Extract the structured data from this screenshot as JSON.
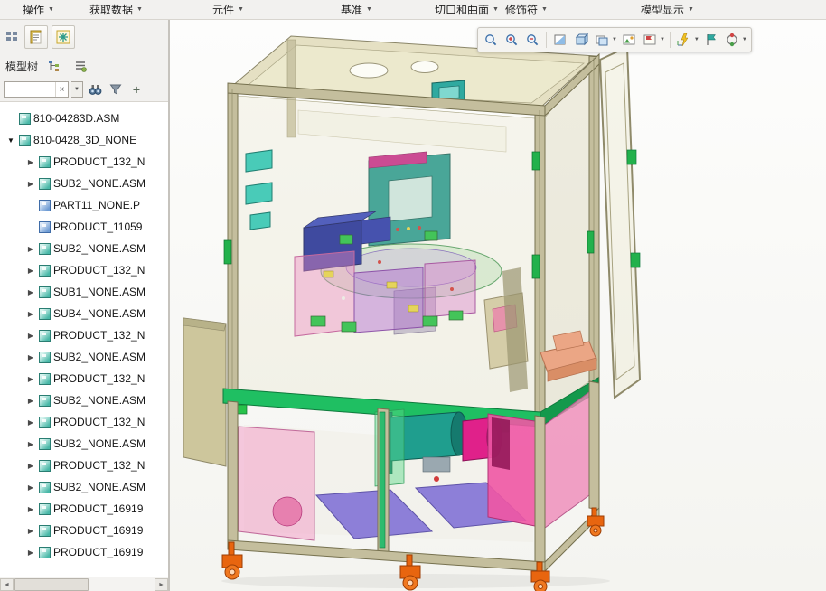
{
  "icons": {
    "caret_glyph": "▼",
    "expander_open": "▼",
    "expander_closed": "▶",
    "clear_glyph": "×",
    "plus_glyph": "+",
    "scroll_left_glyph": "◄",
    "scroll_right_glyph": "►"
  },
  "menubar": {
    "items": [
      {
        "label": "操作"
      },
      {
        "label": "获取数据"
      },
      {
        "label": "元件"
      },
      {
        "label": "基准"
      },
      {
        "label": "切口和曲面"
      },
      {
        "label": "修饰符"
      },
      {
        "label": "模型显示"
      }
    ]
  },
  "quick_access": {
    "buttons": [
      {
        "name": "navigator-toggle"
      },
      {
        "name": "paste"
      },
      {
        "name": "regenerate"
      }
    ]
  },
  "model_tree": {
    "title": "模型树",
    "search": {
      "value": "",
      "placeholder": ""
    },
    "items": [
      {
        "level": 0,
        "expander": "none",
        "icon": "assembly",
        "label": "810-04283D.ASM"
      },
      {
        "level": 0,
        "expander": "open",
        "icon": "assembly",
        "label": "810-0428_3D_NONE"
      },
      {
        "level": 1,
        "expander": "closed",
        "icon": "assembly",
        "label": "PRODUCT_132_N"
      },
      {
        "level": 1,
        "expander": "closed",
        "icon": "assembly",
        "label": "SUB2_NONE.ASM"
      },
      {
        "level": 1,
        "expander": "none",
        "icon": "part",
        "label": "PART11_NONE.P"
      },
      {
        "level": 1,
        "expander": "none",
        "icon": "part",
        "label": "PRODUCT_11059"
      },
      {
        "level": 1,
        "expander": "closed",
        "icon": "assembly",
        "label": "SUB2_NONE.ASM"
      },
      {
        "level": 1,
        "expander": "closed",
        "icon": "assembly",
        "label": "PRODUCT_132_N"
      },
      {
        "level": 1,
        "expander": "closed",
        "icon": "assembly",
        "label": "SUB1_NONE.ASM"
      },
      {
        "level": 1,
        "expander": "closed",
        "icon": "assembly",
        "label": "SUB4_NONE.ASM"
      },
      {
        "level": 1,
        "expander": "closed",
        "icon": "assembly",
        "label": "PRODUCT_132_N"
      },
      {
        "level": 1,
        "expander": "closed",
        "icon": "assembly",
        "label": "SUB2_NONE.ASM"
      },
      {
        "level": 1,
        "expander": "closed",
        "icon": "assembly",
        "label": "PRODUCT_132_N"
      },
      {
        "level": 1,
        "expander": "closed",
        "icon": "assembly",
        "label": "SUB2_NONE.ASM"
      },
      {
        "level": 1,
        "expander": "closed",
        "icon": "assembly",
        "label": "PRODUCT_132_N"
      },
      {
        "level": 1,
        "expander": "closed",
        "icon": "assembly",
        "label": "SUB2_NONE.ASM"
      },
      {
        "level": 1,
        "expander": "closed",
        "icon": "assembly",
        "label": "PRODUCT_132_N"
      },
      {
        "level": 1,
        "expander": "closed",
        "icon": "assembly",
        "label": "SUB2_NONE.ASM"
      },
      {
        "level": 1,
        "expander": "closed",
        "icon": "assembly",
        "label": "PRODUCT_16919"
      },
      {
        "level": 1,
        "expander": "closed",
        "icon": "assembly",
        "label": "PRODUCT_16919"
      },
      {
        "level": 1,
        "expander": "closed",
        "icon": "assembly",
        "label": "PRODUCT_16919"
      }
    ]
  },
  "viewport_toolbar": {
    "icons": [
      {
        "name": "zoom-region"
      },
      {
        "name": "zoom-in"
      },
      {
        "name": "zoom-out"
      },
      {
        "name": "separator"
      },
      {
        "name": "refit"
      },
      {
        "name": "display-shaded"
      },
      {
        "name": "display-style",
        "caret": true
      },
      {
        "name": "saved-views"
      },
      {
        "name": "view-images",
        "caret": true
      },
      {
        "name": "separator"
      },
      {
        "name": "datum-display-filter",
        "caret": true
      },
      {
        "name": "annotation-display"
      },
      {
        "name": "spin-center",
        "caret": true
      }
    ]
  },
  "viewport": {
    "model_colors": {
      "frame": "#c4be9d",
      "guard_panels": "#d8d3ab",
      "work_table_green": "#1fbf62",
      "lower_panel_pink": "#f056a4",
      "floor_panel_purple": "#8d7fd8",
      "feet_orange": "#e8650f",
      "interior_teal": "#2e9e96",
      "interior_blue": "#22309e"
    }
  }
}
